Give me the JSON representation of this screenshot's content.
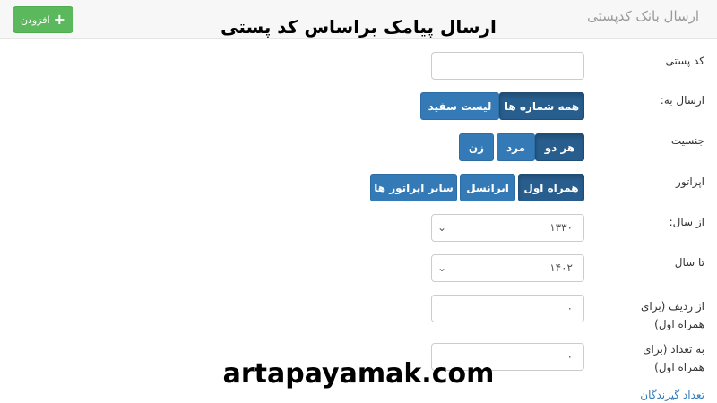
{
  "header": {
    "panel_title": "ارسال بانک کدپستی",
    "add_button_label": "افزودن",
    "overlay_title": "ارسال پیامک براساس کد پستی"
  },
  "form": {
    "postal_code": {
      "label": "کد پستی",
      "value": ""
    },
    "send_to": {
      "label": "ارسال به:",
      "options": [
        "همه شماره ها",
        "لیست سفید"
      ],
      "active": "همه شماره ها"
    },
    "gender": {
      "label": "جنسیت",
      "options": [
        "هر دو",
        "مرد",
        "زن"
      ],
      "active": "هر دو"
    },
    "operator": {
      "label": "اپراتور",
      "options": [
        "همراه اول",
        "ایرانسل",
        "سایر اپراتور ها"
      ],
      "active": "همراه اول"
    },
    "from_year": {
      "label": "از سال:",
      "value": "۱۳۳۰"
    },
    "to_year": {
      "label": "تا سال",
      "value": "۱۴۰۲"
    },
    "from_row": {
      "label": "از ردیف (برای همراه اول)",
      "value": "۰"
    },
    "count": {
      "label": "به تعداد (برای همراه اول)",
      "value": "۰"
    }
  },
  "recipients_link": "تعداد گیرندگان",
  "watermark": "artapayamak.com",
  "colors": {
    "primary": "#337ab7",
    "primary_active": "#285e8e",
    "success": "#5cb85c"
  }
}
